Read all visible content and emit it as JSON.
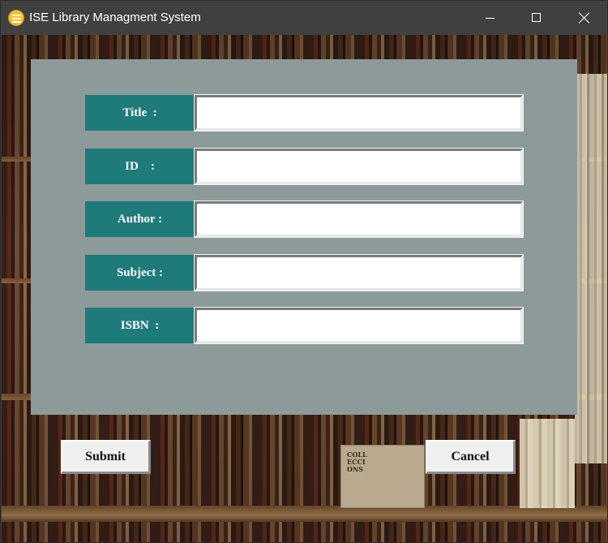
{
  "window": {
    "title": "ISE Library Managment System",
    "icon": "app-icon"
  },
  "controls": {
    "minimize": "minimize-icon",
    "maximize": "maximize-icon",
    "close": "close-icon"
  },
  "background": {
    "box_text": "COLL\nECCI\nONS"
  },
  "form": {
    "fields": [
      {
        "label": "Title  :",
        "value": ""
      },
      {
        "label": "ID    :",
        "value": ""
      },
      {
        "label": "Author :",
        "value": ""
      },
      {
        "label": "Subject :",
        "value": ""
      },
      {
        "label": "ISBN  :",
        "value": ""
      }
    ]
  },
  "buttons": {
    "submit": "Submit",
    "cancel": "Cancel"
  },
  "colors": {
    "label_bg": "#1f7a7a",
    "panel_bg": "#8c9a9a",
    "titlebar_bg": "#404040"
  }
}
